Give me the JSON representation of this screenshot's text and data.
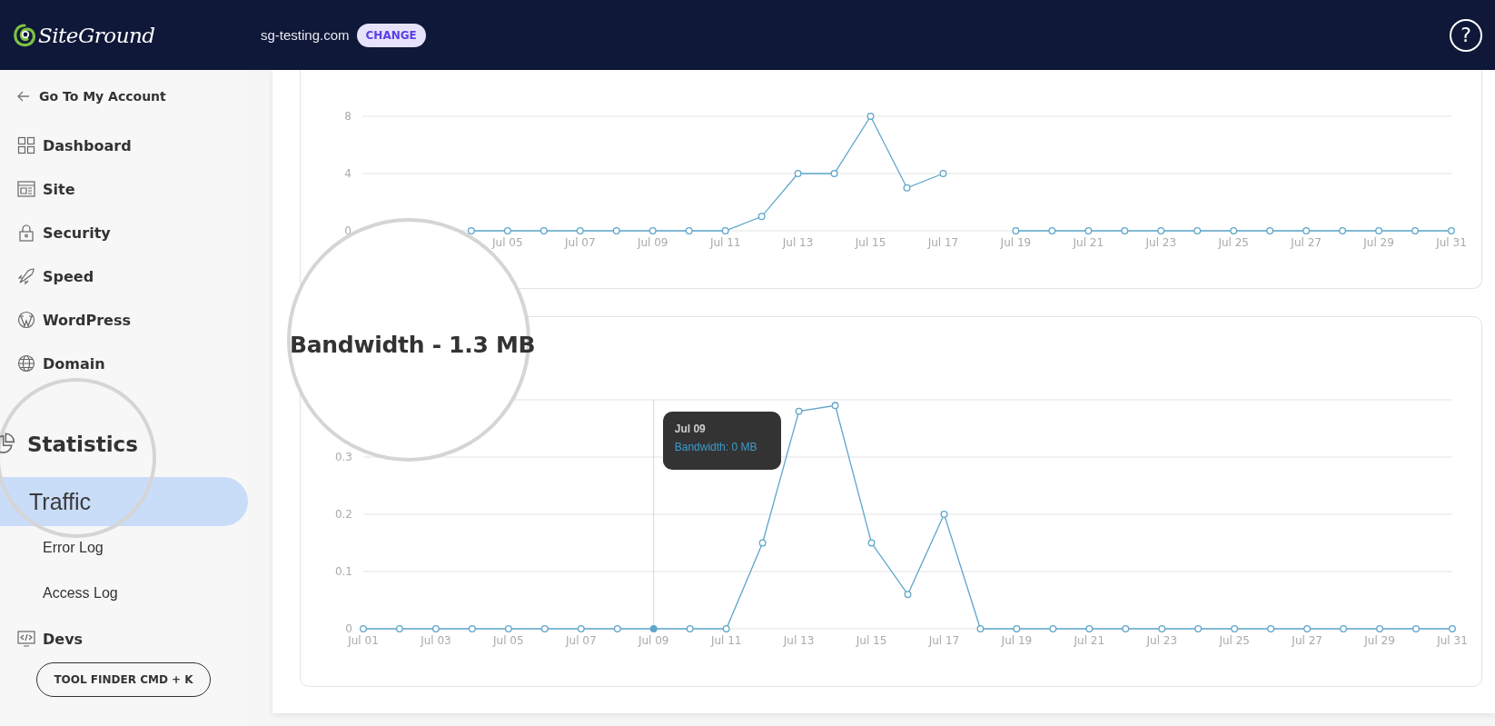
{
  "header": {
    "logo": "SiteGround",
    "domain": "sg-testing.com",
    "change_button": "CHANGE",
    "help": "?"
  },
  "sidebar": {
    "back_link": "Go To My Account",
    "items": [
      {
        "label": "Dashboard",
        "kind": "section",
        "magnified": false
      },
      {
        "label": "Site",
        "kind": "section",
        "magnified": false
      },
      {
        "label": "Security",
        "kind": "section",
        "magnified": false
      },
      {
        "label": "Speed",
        "kind": "section",
        "magnified": false
      },
      {
        "label": "WordPress",
        "kind": "section",
        "magnified": false
      },
      {
        "label": "Domain",
        "kind": "section",
        "magnified": false
      },
      {
        "label": "Statistics",
        "kind": "section",
        "magnified": true,
        "children": [
          {
            "label": "Traffic",
            "selected": true,
            "magnified": true
          },
          {
            "label": "Error Log",
            "selected": false,
            "magnified": false
          },
          {
            "label": "Access Log",
            "selected": false,
            "magnified": false
          }
        ]
      },
      {
        "label": "Devs",
        "kind": "section",
        "magnified": false
      }
    ],
    "tool_finder": "TOOL FINDER CMD + K"
  },
  "cards": [
    {
      "chart_data": {
        "type": "line",
        "grid": true,
        "categories": [
          null,
          null,
          null,
          null,
          "Jul 05",
          null,
          "Jul 07",
          null,
          "Jul 09",
          null,
          "Jul 11",
          null,
          "Jul 13",
          null,
          "Jul 15",
          null,
          "Jul 17",
          null,
          "Jul 19",
          null,
          "Jul 21",
          null,
          "Jul 23",
          null,
          "Jul 25",
          null,
          "Jul 27",
          null,
          "Jul 29",
          null,
          "Jul 31"
        ],
        "ylim": [
          0,
          8
        ],
        "yticks": [
          0,
          4,
          8
        ],
        "series": [
          {
            "color": "#5ea6cb",
            "marker": true,
            "values": [
              null,
              null,
              null,
              0,
              0,
              0,
              0,
              0,
              0,
              0,
              0,
              1,
              4,
              4,
              8,
              3,
              4,
              null,
              0,
              0,
              0,
              0,
              0,
              0,
              0,
              0,
              0,
              0,
              0,
              0,
              0
            ]
          }
        ]
      }
    },
    {
      "title": "Bandwidth - 1.3 MB",
      "magnified": true,
      "tooltip_title": "Jul 09",
      "chart_data": {
        "type": "line",
        "grid": true,
        "categories": [
          "Jul 01",
          null,
          "Jul 03",
          null,
          "Jul 05",
          null,
          "Jul 07",
          null,
          "Jul 09",
          null,
          "Jul 11",
          null,
          "Jul 13",
          null,
          "Jul 15",
          null,
          "Jul 17",
          null,
          "Jul 19",
          null,
          "Jul 21",
          null,
          "Jul 23",
          null,
          "Jul 25",
          null,
          "Jul 27",
          null,
          "Jul 29",
          null,
          "Jul 31"
        ],
        "ylim": [
          0,
          0.4
        ],
        "yticks": [
          0,
          0.1,
          0.2,
          0.3
        ],
        "series": [
          {
            "color": "#5ea6cb",
            "marker": true,
            "values": [
              0,
              0,
              0,
              0,
              0,
              0,
              0,
              0,
              0,
              0,
              0,
              0.15,
              0.38,
              0.39,
              0.15,
              0.06,
              0.2,
              0,
              0,
              0,
              0,
              0,
              0,
              0,
              0,
              0,
              0,
              0,
              0,
              0,
              0
            ]
          }
        ],
        "ref_lines": [
          {
            "axis": "x",
            "value": "Jul 09"
          }
        ],
        "annotations": [
          "Bandwidth: 0 MB"
        ]
      }
    }
  ]
}
